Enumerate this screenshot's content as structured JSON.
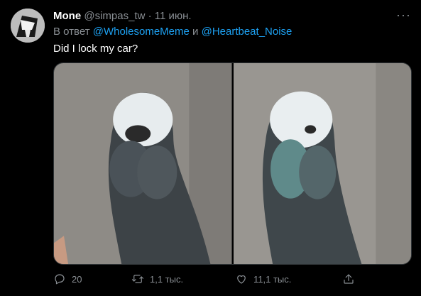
{
  "tweet": {
    "display_name": "Mone",
    "handle": "@simpas_tw",
    "separator": "·",
    "date": "11 июн.",
    "more_icon": "more-horizontal-icon",
    "reply_prefix": "В ответ",
    "reply_user_1": "@WholesomeMeme",
    "reply_conjunction": "и",
    "reply_user_2": "@Heartbeat_Noise",
    "text": "Did I lock my car?",
    "accent_color": "#1da1f2"
  },
  "actions": {
    "reply_count": "20",
    "retweet_count": "1,1 тыс.",
    "like_count": "11,1 тыс.",
    "icons": [
      "reply-icon",
      "retweet-icon",
      "like-icon",
      "share-icon"
    ]
  }
}
